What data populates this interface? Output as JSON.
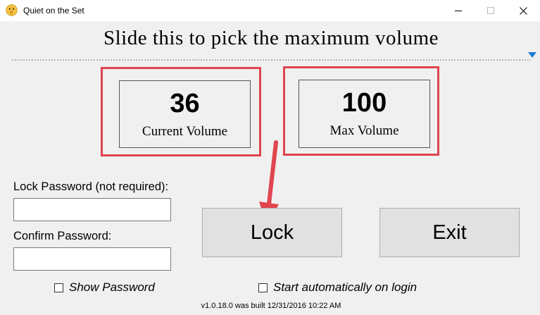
{
  "window": {
    "title": "Quiet on the Set",
    "minimize_symbol": "—",
    "maximize_symbol": "☐",
    "close_symbol": "✕"
  },
  "heading": "Slide this to pick the maximum volume",
  "slider": {
    "value": 100,
    "max": 100
  },
  "current_volume": {
    "value": "36",
    "label": "Current Volume"
  },
  "max_volume": {
    "value": "100",
    "label": "Max Volume"
  },
  "lock_password": {
    "label": "Lock Password (not required):",
    "value": "",
    "placeholder": ""
  },
  "confirm_password": {
    "label": "Confirm Password:",
    "value": "",
    "placeholder": ""
  },
  "buttons": {
    "lock_label": "Lock",
    "exit_label": "Exit"
  },
  "checkboxes": {
    "show_password_label": "Show Password",
    "show_password_checked": false,
    "start_auto_label": "Start automatically on login",
    "start_auto_checked": false
  },
  "version": "v1.0.18.0 was built 12/31/2016 10:22 AM",
  "colors": {
    "highlight": "#e0454f",
    "arrow": "#e0454f",
    "slider_thumb": "#1e7bd6",
    "background": "#f0f0f0"
  },
  "icons": {
    "app": "emoji-shush-icon",
    "minimize": "minimize-icon",
    "maximize": "maximize-icon",
    "close": "close-icon",
    "slider_thumb": "slider-thumb-triangle-icon",
    "annotation_arrow": "down-arrow-icon"
  }
}
